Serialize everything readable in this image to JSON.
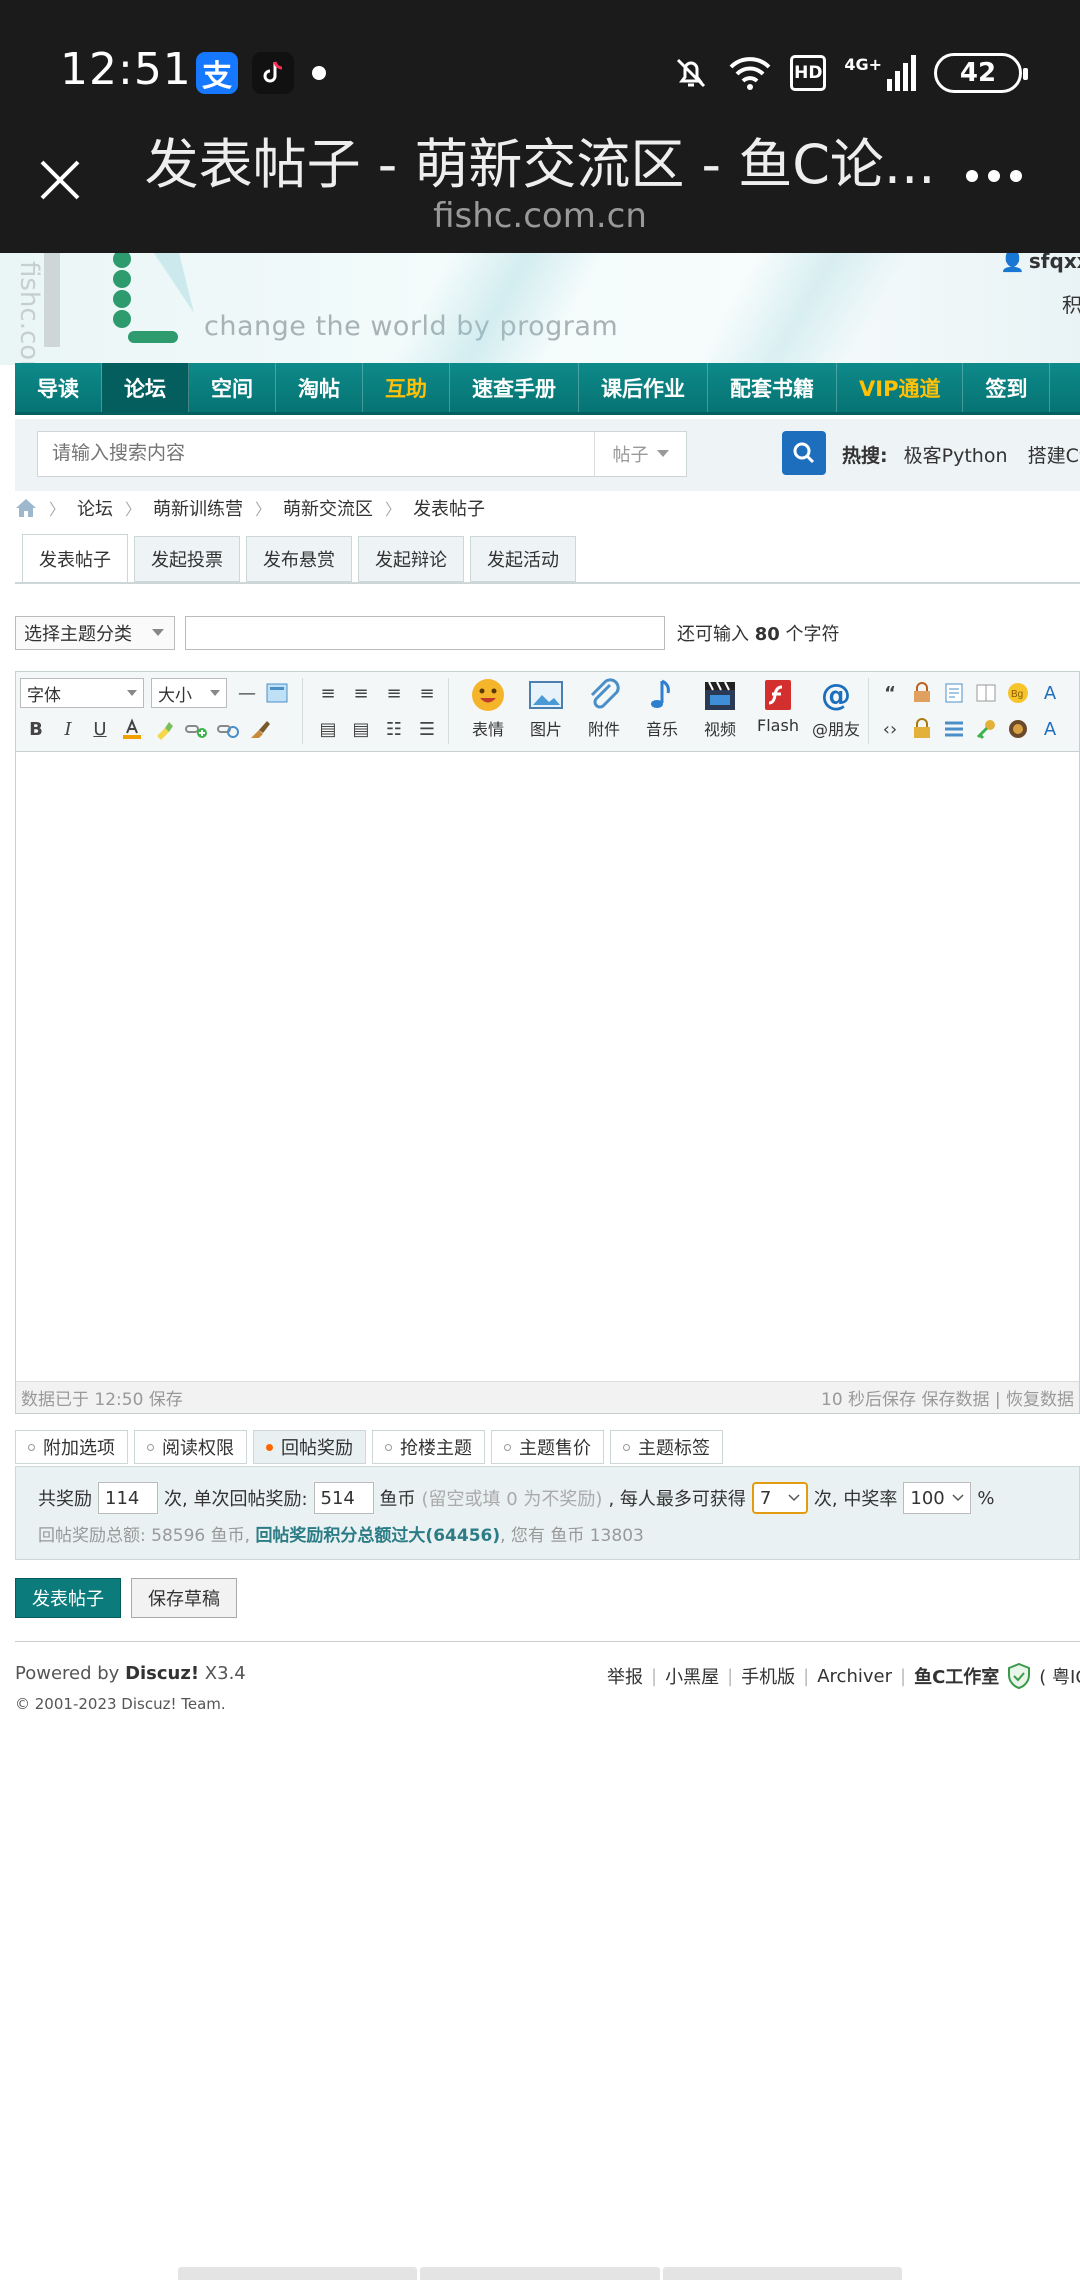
{
  "status_bar": {
    "time": "12:51",
    "hd": "HD",
    "network": "4G+",
    "battery": "42"
  },
  "browser": {
    "title": "发表帖子 - 萌新交流区 - 鱼C论...",
    "url": "fishc.com.cn"
  },
  "header": {
    "logo_text": "fishc.com",
    "slogan": "change the world by program",
    "username": "sfqxx 在",
    "jifen": "积"
  },
  "nav": {
    "items": [
      {
        "label": "导读"
      },
      {
        "label": "论坛"
      },
      {
        "label": "空间"
      },
      {
        "label": "淘帖"
      },
      {
        "label": "互助"
      },
      {
        "label": "速查手册"
      },
      {
        "label": "课后作业"
      },
      {
        "label": "配套书籍"
      },
      {
        "label": "VIP通道"
      },
      {
        "label": "签到"
      }
    ]
  },
  "search": {
    "placeholder": "请输入搜索内容",
    "scope": "帖子",
    "hot_label": "热搜:",
    "hot_items": [
      "极客Python",
      "搭建C语言"
    ]
  },
  "breadcrumb": [
    "论坛",
    "萌新训练营",
    "萌新交流区",
    "发表帖子"
  ],
  "post_tabs": [
    "发表帖子",
    "发起投票",
    "发布悬赏",
    "发起辩论",
    "发起活动"
  ],
  "subject": {
    "type_select": "选择主题分类",
    "remain_prefix": "还可输入",
    "remain_count": "80",
    "remain_suffix": "个字符"
  },
  "toolbar": {
    "font": "字体",
    "size": "大小",
    "bold": "B",
    "italic": "I",
    "underline": "U",
    "big_buttons": [
      "表情",
      "图片",
      "附件",
      "音乐",
      "视频",
      "Flash",
      "@朋友"
    ]
  },
  "editor_status": {
    "left": "数据已于 12:50 保存",
    "right": "10 秒后保存 保存数据 | 恢复数据"
  },
  "option_tabs": [
    "附加选项",
    "阅读权限",
    "回帖奖励",
    "抢楼主题",
    "主题售价",
    "主题标签"
  ],
  "reward": {
    "total_label": "共奖励",
    "total_value": "114",
    "times_label": "次, 单次回帖奖励:",
    "single_value": "514",
    "coin_label": "鱼币",
    "coin_hint": "(留空或填 0 为不奖励)",
    "max_label": ", 每人最多可获得",
    "max_value": "7",
    "rate_label": "次, 中奖率",
    "rate_value": "100",
    "percent": "%",
    "summary_prefix": "回帖奖励总额: 58596 鱼币,",
    "summary_warn": "回帖奖励积分总额过大(64456)",
    "summary_suffix": ", 您有 鱼币 13803"
  },
  "buttons": {
    "submit": "发表帖子",
    "draft": "保存草稿"
  },
  "footer": {
    "powered_prefix": "Powered by",
    "powered_name": "Discuz!",
    "version": "X3.4",
    "copyright": "© 2001-2023 Discuz! Team.",
    "links": [
      "举报",
      "小黑屋",
      "手机版",
      "Archiver",
      "鱼C工作室",
      "( 粤ICP"
    ]
  },
  "colors": {
    "nav_bg": "#0e8a8a",
    "nav_highlight": "#ffc107",
    "primary_button": "#0b7b7c",
    "search_button": "#1d6fbe"
  }
}
